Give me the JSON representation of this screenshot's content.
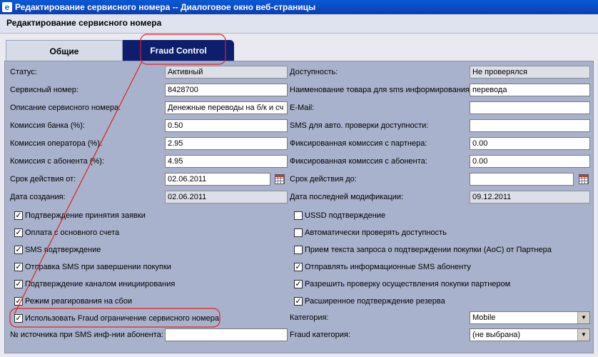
{
  "window": {
    "title": "Редактирование сервисного номера -- Диалоговое окно веб-страницы"
  },
  "header": {
    "title": "Редактирование сервисного номера"
  },
  "tabs": [
    {
      "label": "Общие"
    },
    {
      "label": "Fraud Control"
    }
  ],
  "left_fields": [
    {
      "label": "Статус:",
      "value": "Активный"
    },
    {
      "label": "Сервисный номер:",
      "value": "8428700"
    },
    {
      "label": "Описание сервисного номера:",
      "value": "Денежные переводы на б/к и сч"
    },
    {
      "label": "Комиссия банка (%):",
      "value": "0.50"
    },
    {
      "label": "Комиссия оператора (%):",
      "value": "2.95"
    },
    {
      "label": "Комиссия с абонента (%):",
      "value": "4.95"
    },
    {
      "label": "Срок действия от:",
      "value": "02.06.2011"
    },
    {
      "label": "Дата создания:",
      "value": "02.06.2011"
    }
  ],
  "right_fields": [
    {
      "label": "Доступность:",
      "value": "Не проверялся"
    },
    {
      "label": "Наименование товара для sms информирования:",
      "value": "перевода"
    },
    {
      "label": "E-Mail:",
      "value": ""
    },
    {
      "label": "SMS для авто. проверки доступности:",
      "value": ""
    },
    {
      "label": "Фиксированная комиссия с партнера:",
      "value": "0.00"
    },
    {
      "label": "Фиксированная комиссия с абонента:",
      "value": "0.00"
    },
    {
      "label": "Срок действия до:",
      "value": ""
    },
    {
      "label": "Дата последней модификации:",
      "value": "09.12.2011"
    }
  ],
  "left_checks": [
    {
      "label": "Подтверждение принятия заявки",
      "checked": true
    },
    {
      "label": "Оплата с основного счета",
      "checked": true
    },
    {
      "label": "SMS подтверждение",
      "checked": true
    },
    {
      "label": "Отправка SMS при завершении покупки",
      "checked": true
    },
    {
      "label": "Подтверждение каналом инициирования",
      "checked": true
    },
    {
      "label": "Режим реагирования на сбои",
      "checked": true
    },
    {
      "label": "Использовать Fraud ограничение сервисного номера",
      "checked": true
    }
  ],
  "right_checks": [
    {
      "label": "USSD подтверждение",
      "checked": false
    },
    {
      "label": "Автоматически проверять доступность",
      "checked": false
    },
    {
      "label": "Прием текста запроса о подтверждении покупки (AoC) от Партнера",
      "checked": false
    },
    {
      "label": "Отправлять информационные SMS абоненту",
      "checked": true
    },
    {
      "label": "Разрешить проверку осуществления покупки партнером",
      "checked": true
    },
    {
      "label": "Расширенное подтверждение резерва",
      "checked": true
    }
  ],
  "bottom": {
    "source_label": "№ источника при SMS инф-нии абонента:",
    "source_value": "",
    "category_label": "Категория:",
    "category_value": "Mobile",
    "fraud_category_label": "Fraud категория:",
    "fraud_category_value": "(не выбрана)"
  },
  "colors": {
    "annotation": "#e02020",
    "active_tab": "#0d1f6c",
    "panel": "#a9b2cc"
  }
}
